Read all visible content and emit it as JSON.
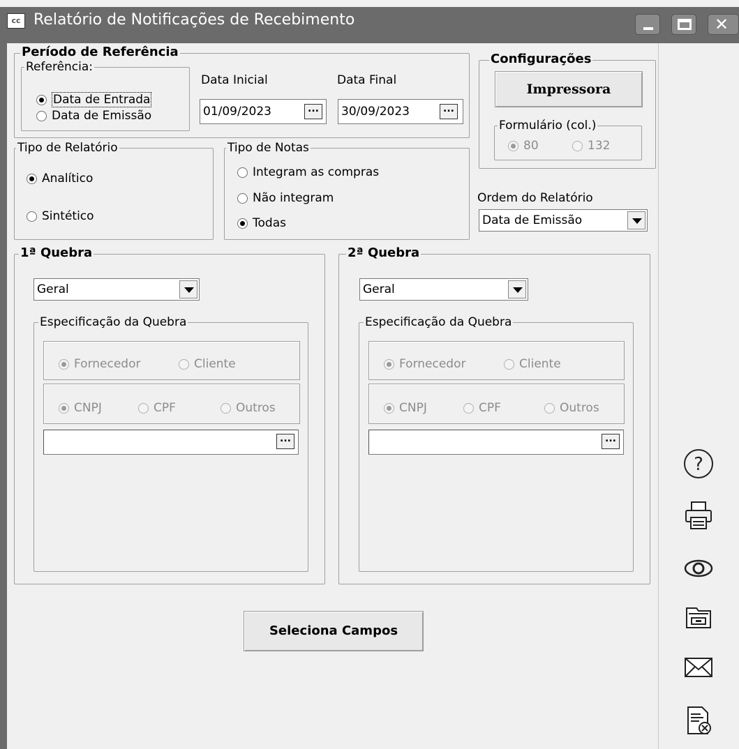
{
  "window": {
    "app_icon_text": "cc",
    "title": "Relatório de Notificações de Recebimento"
  },
  "periodo": {
    "legend": "Período de Referência",
    "referencia_legend": "Referência:",
    "opt_entrada": "Data de Entrada",
    "opt_emissao": "Data de Emissão",
    "selected": "entrada",
    "data_inicial_label": "Data Inicial",
    "data_inicial": "01/09/2023",
    "data_final_label": "Data Final",
    "data_final": "30/09/2023",
    "ellipsis": "..."
  },
  "config": {
    "legend": "Configurações",
    "impressora_label": "Impressora",
    "formulario_legend": "Formulário (col.)",
    "opt_80": "80",
    "opt_132": "132",
    "selected": "80"
  },
  "tipo_relatorio": {
    "legend": "Tipo de Relatório",
    "opt_analitico": "Analítico",
    "opt_sintetico": "Sintético",
    "selected": "analitico"
  },
  "tipo_notas": {
    "legend": "Tipo de Notas",
    "opt_integram": "Integram as compras",
    "opt_nao_integram": "Não integram",
    "opt_todas": "Todas",
    "selected": "todas"
  },
  "ordem": {
    "label": "Ordem do Relatório",
    "value": "Data de Emissão"
  },
  "quebra1": {
    "legend": "1ª Quebra",
    "combo_value": "Geral",
    "spec_legend": "Especificação da Quebra",
    "opt_fornecedor": "Fornecedor",
    "opt_cliente": "Cliente",
    "opt_cnpj": "CNPJ",
    "opt_cpf": "CPF",
    "opt_outros": "Outros",
    "input_value": ""
  },
  "quebra2": {
    "legend": "2ª Quebra",
    "combo_value": "Geral",
    "spec_legend": "Especificação da Quebra",
    "opt_fornecedor": "Fornecedor",
    "opt_cliente": "Cliente",
    "opt_cnpj": "CNPJ",
    "opt_cpf": "CPF",
    "opt_outros": "Outros",
    "input_value": ""
  },
  "actions": {
    "seleciona_campos": "Seleciona Campos"
  },
  "side_icons": [
    "help-icon",
    "printer-icon",
    "preview-eye-icon",
    "export-folder-icon",
    "email-icon",
    "cancel-document-icon"
  ]
}
